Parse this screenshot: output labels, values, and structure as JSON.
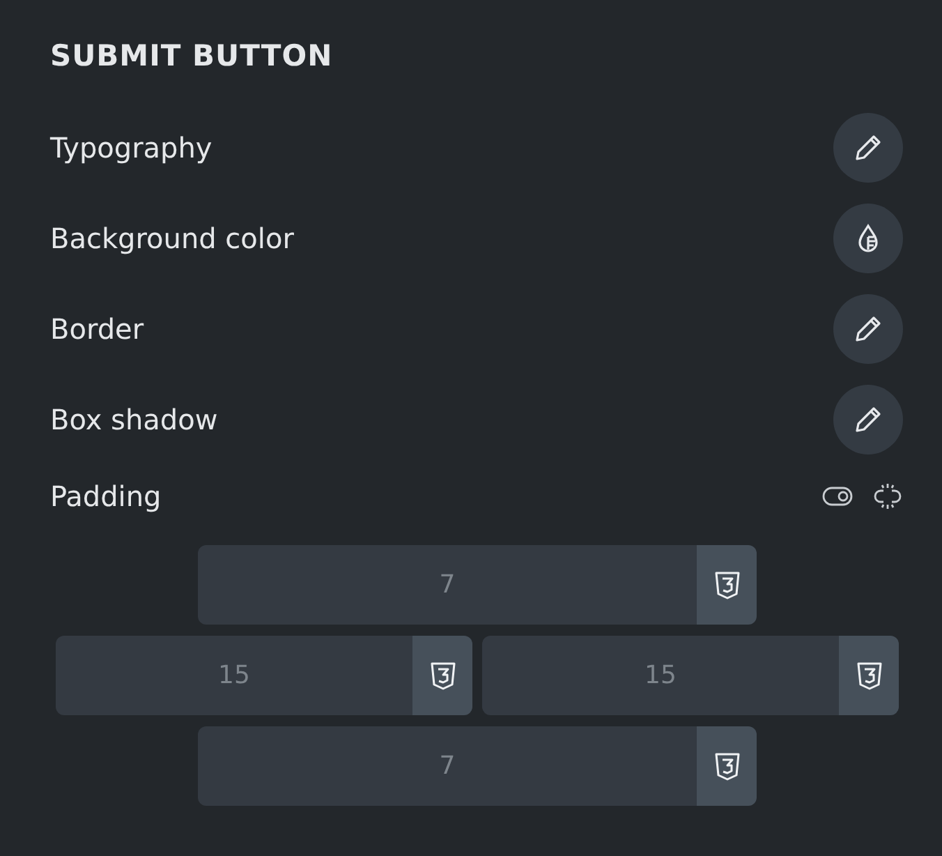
{
  "section_title": "SUBMIT BUTTON",
  "rows": [
    {
      "label": "Typography",
      "kind": "edit"
    },
    {
      "label": "Background color",
      "kind": "color"
    },
    {
      "label": "Border",
      "kind": "edit"
    },
    {
      "label": "Box shadow",
      "kind": "edit"
    }
  ],
  "padding": {
    "label": "Padding",
    "fields": [
      {
        "kind": "wide",
        "placeholder": "7"
      },
      {
        "kind": "half",
        "placeholder": "15"
      },
      {
        "kind": "half",
        "placeholder": "15"
      },
      {
        "kind": "wide",
        "placeholder": "7"
      }
    ]
  }
}
